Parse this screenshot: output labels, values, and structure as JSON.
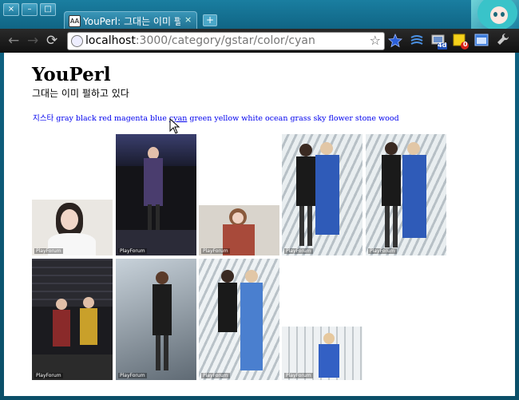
{
  "window": {
    "controls": [
      "×",
      "–",
      "□"
    ]
  },
  "tab": {
    "title": "YouPerl: 그대는 이미 펄하",
    "close": "×",
    "favicon_text": "AA"
  },
  "new_tab": "+",
  "toolbar": {
    "back_icon": "←",
    "forward_icon": "→",
    "reload_icon": "⟳",
    "url_host": "localhost",
    "url_path": ":3000/category/gstar/color/cyan",
    "bookmark_star": "☆",
    "extension_badges": [
      "4d",
      "0"
    ],
    "wrench": "🔧"
  },
  "page": {
    "title": "YouPerl",
    "tagline": "그대는 이미 펄하고 있다",
    "categories": [
      {
        "label": "지스타",
        "active": false
      },
      {
        "label": "gray",
        "active": false
      },
      {
        "label": "black",
        "active": false
      },
      {
        "label": "red",
        "active": false
      },
      {
        "label": "magenta",
        "active": false
      },
      {
        "label": "blue",
        "active": false
      },
      {
        "label": "cyan",
        "active": true
      },
      {
        "label": "green",
        "active": false
      },
      {
        "label": "yellow",
        "active": false
      },
      {
        "label": "white",
        "active": false
      },
      {
        "label": "ocean",
        "active": false
      },
      {
        "label": "grass",
        "active": false
      },
      {
        "label": "sky",
        "active": false
      },
      {
        "label": "flower",
        "active": false
      },
      {
        "label": "stone",
        "active": false
      },
      {
        "label": "wood",
        "active": false
      }
    ],
    "watermark": "PlayForum"
  },
  "colors": {
    "link": "#0000ee",
    "frame": "#0f6282"
  }
}
